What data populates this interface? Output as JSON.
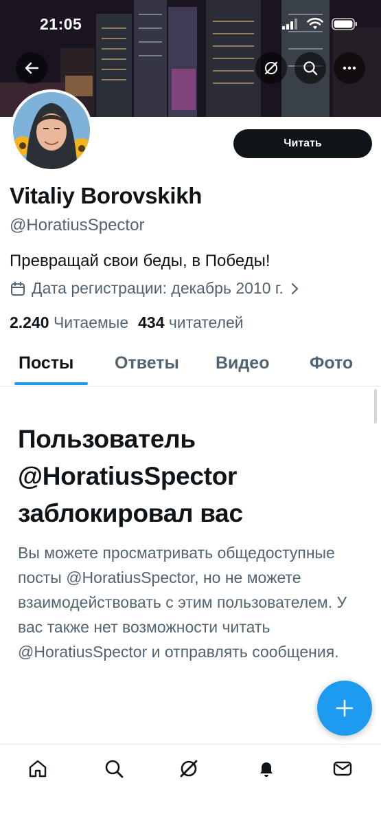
{
  "status_bar": {
    "time": "21:05"
  },
  "nav": {
    "back_icon": "arrow-left-icon",
    "grok_icon": "grok-icon",
    "search_icon": "search-icon",
    "more_icon": "more-icon"
  },
  "profile": {
    "display_name": "Vitaliy Borovskikh",
    "handle": "@HoratiusSpector",
    "bio": "Превращай свои беды, в Победы!",
    "joined": "Дата регистрации: декабрь 2010 г.",
    "following_count": "2.240",
    "following_label": "Читаемые",
    "followers_count": "434",
    "followers_label": "читателей",
    "follow_button": "Читать"
  },
  "tabs": [
    {
      "label": "Посты",
      "active": true
    },
    {
      "label": "Ответы",
      "active": false
    },
    {
      "label": "Видео",
      "active": false
    },
    {
      "label": "Фото",
      "active": false
    }
  ],
  "blocked": {
    "title": "Пользователь @HoratiusSpector заблокировал вас",
    "message": "Вы можете просматривать общедоступные посты @HoratiusSpector, но не можете взаимодействовать с этим пользователем. У вас также нет возможности читать @HoratiusSpector и отправлять сообщения."
  },
  "bottom_nav": [
    "home-icon",
    "search-icon",
    "grok-icon",
    "notifications-icon",
    "messages-icon"
  ],
  "colors": {
    "accent": "#1d9bf0",
    "text": "#0f1419",
    "secondary": "#536471"
  }
}
